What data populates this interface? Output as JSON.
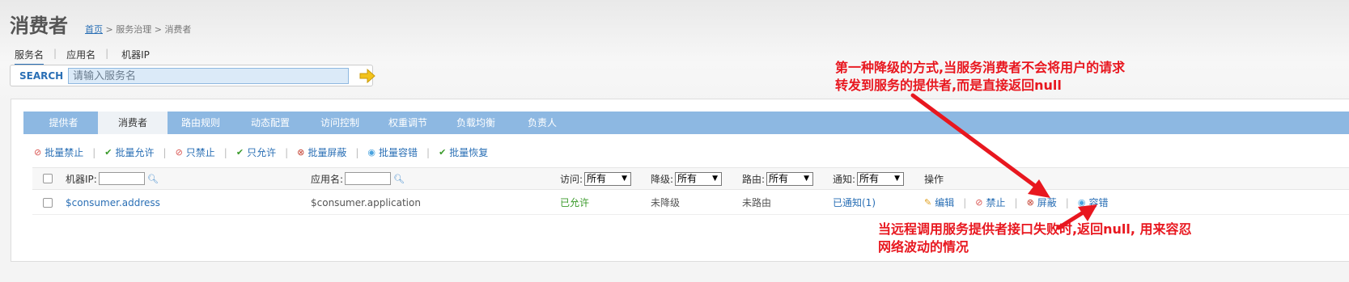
{
  "page": {
    "title": "消费者"
  },
  "breadcrumb": {
    "home": "首页",
    "sep1": " > ",
    "section": "服务治理",
    "sep2": " > ",
    "current": "消费者"
  },
  "search_tabs": [
    "服务名",
    "应用名",
    "机器IP"
  ],
  "search": {
    "label": "SEARCH",
    "placeholder": "请输入服务名"
  },
  "tabs": [
    "提供者",
    "消费者",
    "路由规则",
    "动态配置",
    "访问控制",
    "权重调节",
    "负载均衡",
    "负责人"
  ],
  "active_tab": "消费者",
  "actions": [
    {
      "label": "批量禁止",
      "icon": "ban-icon"
    },
    {
      "label": "批量允许",
      "icon": "check-icon"
    },
    {
      "label": "只禁止",
      "icon": "ban-icon"
    },
    {
      "label": "只允许",
      "icon": "check-icon"
    },
    {
      "label": "批量屏蔽",
      "icon": "block-icon"
    },
    {
      "label": "批量容错",
      "icon": "tolerance-icon"
    },
    {
      "label": "批量恢复",
      "icon": "check-icon"
    }
  ],
  "grid_header": {
    "machine_ip": "机器IP:",
    "app_name": "应用名:",
    "access": {
      "label": "访问:",
      "value": "所有"
    },
    "degrade": {
      "label": "降级:",
      "value": "所有"
    },
    "route": {
      "label": "路由:",
      "value": "所有"
    },
    "notify": {
      "label": "通知:",
      "value": "所有"
    },
    "operations": "操作"
  },
  "rows": [
    {
      "address": "$consumer.address",
      "application": "$consumer.application",
      "access": "已允许",
      "degrade": "未降级",
      "route": "未路由",
      "notify": "已通知(1)",
      "ops": [
        "编辑",
        "禁止",
        "屏蔽",
        "容错"
      ]
    }
  ],
  "annotations": {
    "first": [
      "第一种降级的方式,当服务消费者不会将用户的请求",
      "转发到服务的提供者,而是直接返回null"
    ],
    "second": [
      "当远程调用服务提供者接口失败时,返回null, 用来容忍",
      "网络波动的情况"
    ],
    "color": "#e8171f"
  },
  "colors": {
    "tabbar": "#8db8e2",
    "link": "#2a6fb5",
    "search_input_bg": "#dbeaf8"
  }
}
